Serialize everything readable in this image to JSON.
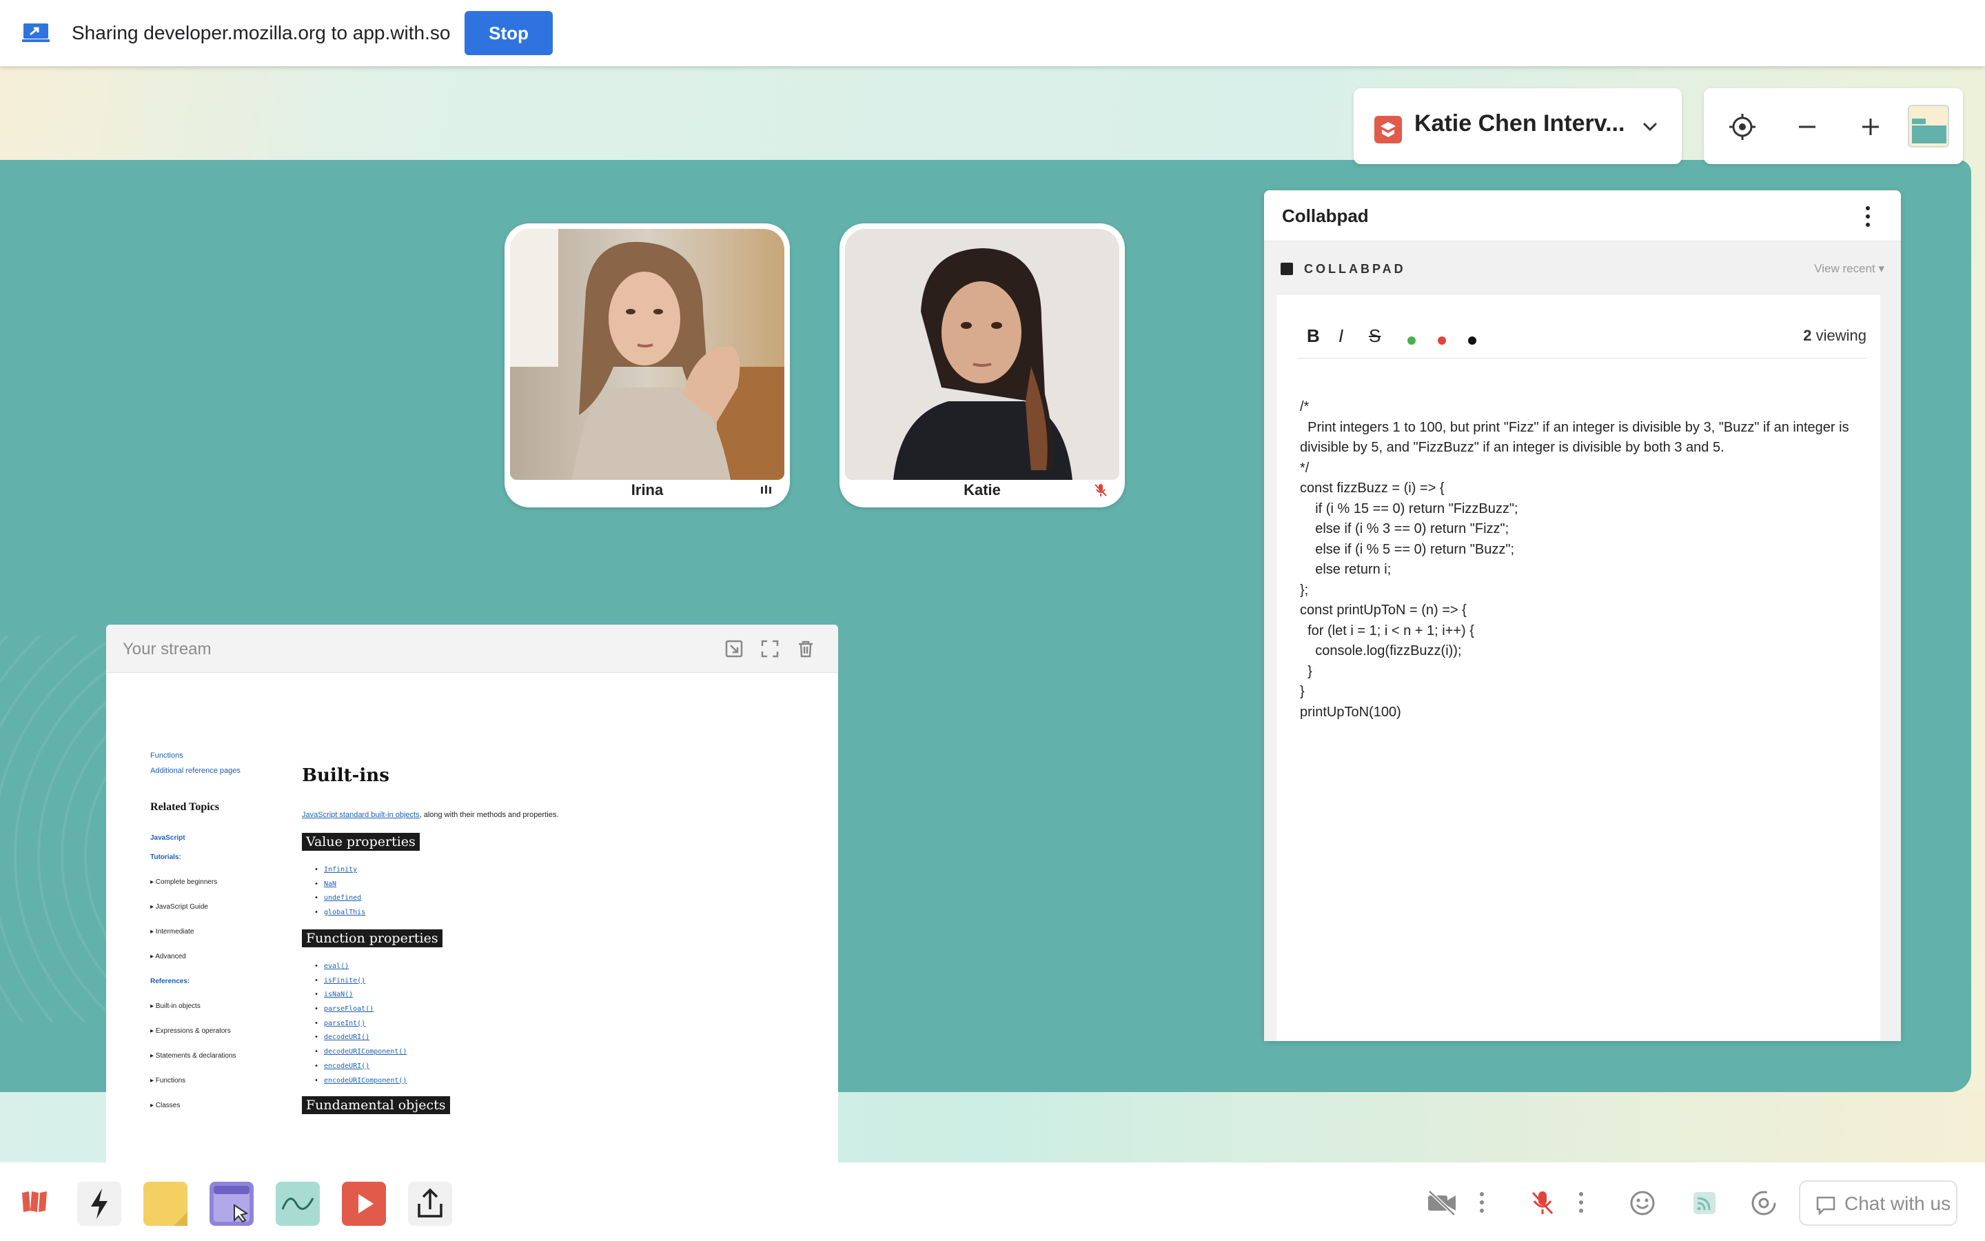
{
  "share_bar": {
    "text": "Sharing developer.mozilla.org to app.with.so",
    "stop_label": "Stop"
  },
  "room": {
    "title": "Katie Chen Interv..."
  },
  "participants": [
    {
      "name": "Irina"
    },
    {
      "name": "Katie"
    }
  ],
  "collabpad": {
    "title": "Collabpad",
    "section_label": "COLLABPAD",
    "view_recent": "View recent",
    "bold": "B",
    "italic": "I",
    "strike": "S",
    "viewing_count": "2",
    "viewing_label": " viewing",
    "code": "/*\n  Print integers 1 to 100, but print \"Fizz\" if an integer is divisible by 3, \"Buzz\" if an integer is divisible by 5, and \"FizzBuzz\" if an integer is divisible by both 3 and 5.\n*/\nconst fizzBuzz = (i) => {\n    if (i % 15 == 0) return \"FizzBuzz\";\n    else if (i % 3 == 0) return \"Fizz\";\n    else if (i % 5 == 0) return \"Buzz\";\n    else return i;\n};\nconst printUpToN = (n) => {\n  for (let i = 1; i < n + 1; i++) {\n    console.log(fizzBuzz(i));\n  }\n}\nprintUpToN(100)",
    "colors": {
      "green": "#4caf50",
      "red": "#e0443a",
      "black": "#111111"
    }
  },
  "stream": {
    "title": "Your stream",
    "page": {
      "side_links": [
        "Functions",
        "Additional reference pages"
      ],
      "related_heading": "Related Topics",
      "side_bold_1": "JavaScript",
      "side_bold_2": "Tutorials:",
      "tutorial_items": [
        "▸ Complete beginners",
        "▸ JavaScript Guide",
        "▸ Intermediate",
        "▸ Advanced"
      ],
      "side_bold_3": "References:",
      "reference_items": [
        "▸ Built-in objects",
        "▸ Expressions & operators",
        "▸ Statements & declarations",
        "▸ Functions",
        "▸ Classes"
      ],
      "heading": "Built-ins",
      "intro_link": "JavaScript standard built-in objects",
      "intro_text": ", along with their methods and properties.",
      "section_1": "Value properties",
      "value_props": [
        "Infinity",
        "NaN",
        "undefined",
        "globalThis"
      ],
      "section_2": "Function properties",
      "function_props": [
        "eval()",
        "isFinite()",
        "isNaN()",
        "parseFloat()",
        "parseInt()",
        "decodeURI()",
        "decodeURIComponent()",
        "encodeURI()",
        "encodeURIComponent()"
      ],
      "section_3": "Fundamental objects"
    }
  },
  "dock": {
    "chat_label": "Chat with us"
  },
  "theme": {
    "teal": "#62b1ab",
    "accent_blue": "#2f73e0",
    "muted_red": "#e25a4a"
  }
}
